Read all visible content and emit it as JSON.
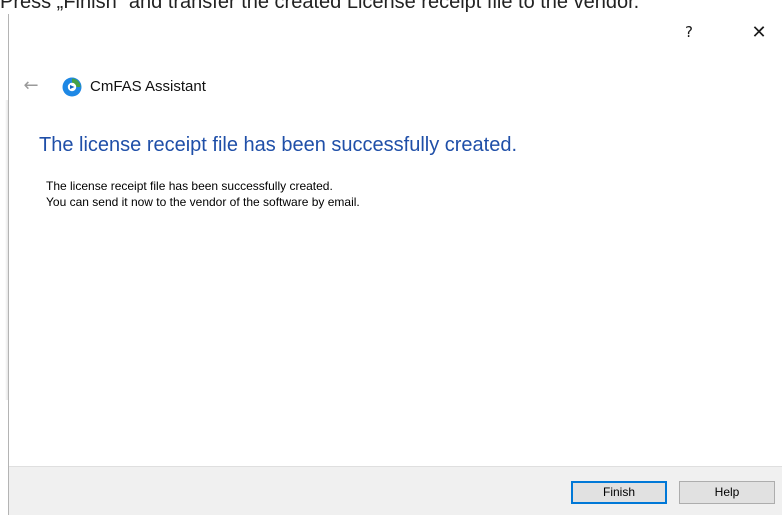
{
  "document": {
    "caption": "Press „Finish“ and transfer the created License receipt file to the vendor."
  },
  "window": {
    "help_button_label": "?",
    "close_button_label": "✕",
    "back_arrow_label": "←",
    "app_title": "CmFAS Assistant",
    "icon": "cmfas-app-icon",
    "heading": "The license receipt file has been successfully created.",
    "body_lines": [
      "The license receipt file has been successfully created.",
      "You can send it now to the vendor of the software by email."
    ],
    "buttons": {
      "finish": "Finish",
      "help": "Help"
    }
  },
  "colors": {
    "heading": "#1f4fa8",
    "icon_blue": "#1e88e5",
    "icon_green": "#43a047",
    "default_button_border": "#0078d7"
  }
}
